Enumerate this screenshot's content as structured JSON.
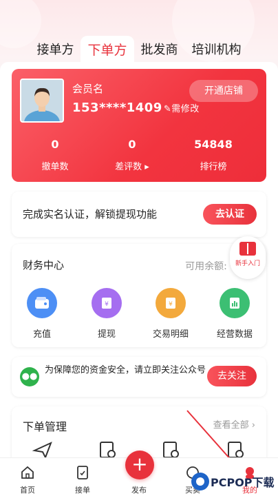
{
  "tabs": [
    {
      "label": "接单方",
      "active": false
    },
    {
      "label": "下单方",
      "active": true
    },
    {
      "label": "批发商",
      "active": false
    },
    {
      "label": "培训机构",
      "active": false
    }
  ],
  "member": {
    "name": "会员名",
    "phone": "153****1409",
    "edit_label": "✎需修改",
    "open_shop_label": "开通店铺",
    "stats": [
      {
        "value": "0",
        "label": "撤单数"
      },
      {
        "value": "0",
        "label": "差评数 ▸"
      },
      {
        "value": "54848",
        "label": "排行榜"
      }
    ]
  },
  "verify": {
    "text": "完成实名认证，解锁提现功能",
    "button": "去认证"
  },
  "finance": {
    "title": "财务中心",
    "balance_label": "可用余额:",
    "balance_masked": "**",
    "items": [
      {
        "label": "充值",
        "icon": "wallet-icon",
        "color": "#4d8ff5"
      },
      {
        "label": "提现",
        "icon": "withdraw-icon",
        "color": "#a56ef0"
      },
      {
        "label": "交易明细",
        "icon": "ledger-icon",
        "color": "#f3a93c"
      },
      {
        "label": "经营数据",
        "icon": "chart-icon",
        "color": "#3cbf73"
      }
    ]
  },
  "newbie": {
    "label": "新手入门"
  },
  "wechat": {
    "text": "为保障您的资金安全，请立即关注公众号",
    "button": "去关注"
  },
  "orders": {
    "title": "下单管理",
    "view_all": "查看全部 ›"
  },
  "nav": [
    {
      "label": "首页",
      "icon": "home-icon"
    },
    {
      "label": "接单",
      "icon": "order-icon"
    },
    {
      "label": "发布",
      "icon": "plus-icon"
    },
    {
      "label": "买卖",
      "icon": "trade-icon"
    },
    {
      "label": "我的",
      "icon": "user-icon"
    }
  ],
  "watermark": {
    "text": "PCPOP下载"
  },
  "colors": {
    "accent": "#e8323c",
    "bg": "#f3f3f5"
  }
}
